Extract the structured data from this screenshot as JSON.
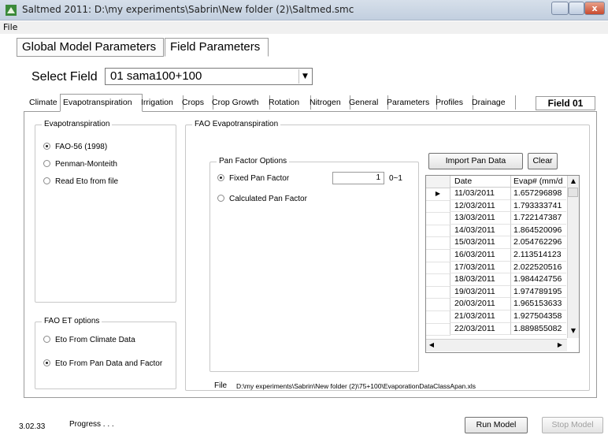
{
  "window": {
    "title": "Saltmed 2011: D:\\my experiments\\Sabrin\\New folder (2)\\Saltmed.smc",
    "close_glyph": "x"
  },
  "menu": {
    "file": "File"
  },
  "main_tabs": {
    "global": "Global Model Parameters",
    "field": "Field Parameters"
  },
  "select_field": {
    "label": "Select Field",
    "value": "01 sama100+100"
  },
  "sub_tabs": [
    "Climate",
    "Evapotranspiration",
    "Irrigation",
    "Crops",
    "Crop Growth",
    "Rotation",
    "Nitrogen",
    "General",
    "Parameters",
    "Profiles",
    "Drainage"
  ],
  "active_sub_tab": "Evapotranspiration",
  "field_badge": "Field 01",
  "evapotranspiration_group": {
    "legend": "Evapotranspiration",
    "options": [
      "FAO-56 (1998)",
      "Penman-Monteith",
      "Read Eto from file"
    ],
    "selected": 0
  },
  "fao_et_options": {
    "legend": "FAO ET options",
    "options": [
      "Eto From Climate Data",
      "Eto From Pan Data and Factor"
    ],
    "selected": 1
  },
  "fao_evapo": {
    "legend": "FAO Evapotranspiration"
  },
  "pan_factor": {
    "legend": "Pan Factor Options",
    "options": [
      "Fixed Pan Factor",
      "Calculated Pan Factor"
    ],
    "selected": 0,
    "value": "1",
    "range": "0~1"
  },
  "buttons": {
    "import": "Import Pan Data",
    "clear": "Clear",
    "run": "Run Model",
    "stop": "Stop Model"
  },
  "grid": {
    "headers": [
      "Date",
      "Evap# (mm/d"
    ],
    "rows": [
      [
        "11/03/2011",
        "1.657296898"
      ],
      [
        "12/03/2011",
        "1.793333741"
      ],
      [
        "13/03/2011",
        "1.722147387"
      ],
      [
        "14/03/2011",
        "1.864520096"
      ],
      [
        "15/03/2011",
        "2.054762296"
      ],
      [
        "16/03/2011",
        "2.113514123"
      ],
      [
        "17/03/2011",
        "2.022520516"
      ],
      [
        "18/03/2011",
        "1.984424756"
      ],
      [
        "19/03/2011",
        "1.974789195"
      ],
      [
        "20/03/2011",
        "1.965153633"
      ],
      [
        "21/03/2011",
        "1.927504358"
      ],
      [
        "22/03/2011",
        "1.889855082"
      ]
    ],
    "current_row_marker": "▶"
  },
  "file": {
    "label": "File",
    "path": "D:\\my experiments\\Sabrin\\New folder (2)\\75+100\\EvaporationDataClassApan.xls"
  },
  "status": {
    "version": "3.02.33",
    "progress": "Progress . . ."
  },
  "colors": {
    "titlebar": "#c8d4e3",
    "close": "#c84b2f",
    "border": "#9a9a9a"
  }
}
